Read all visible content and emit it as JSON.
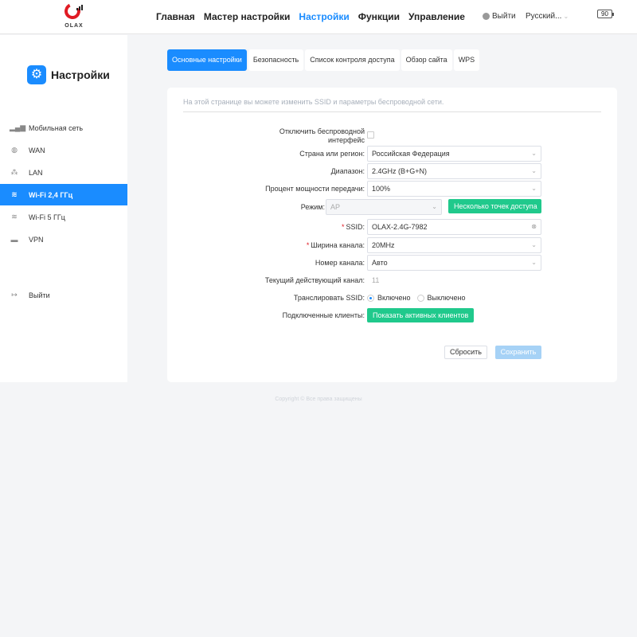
{
  "header": {
    "logo_text": "OLAX",
    "nav": [
      "Главная",
      "Мастер настройки",
      "Настройки",
      "Функции",
      "Управление"
    ],
    "nav_active_index": 2,
    "logout": "Выйти",
    "language": "Русский...",
    "battery": "90"
  },
  "sidebar": {
    "title": "Настройки",
    "items": [
      {
        "label": "Мобильная сеть",
        "icon": "signal-icon"
      },
      {
        "label": "WAN",
        "icon": "globe-icon"
      },
      {
        "label": "LAN",
        "icon": "network-icon"
      },
      {
        "label": "Wi-Fi 2,4 ГГц",
        "icon": "wifi-icon",
        "active": true
      },
      {
        "label": "Wi-Fi 5 ГГц",
        "icon": "wifi-icon"
      },
      {
        "label": "VPN",
        "icon": "vpn-icon"
      }
    ],
    "logout": "Выйти"
  },
  "tabs": [
    "Основные настройки",
    "Безопасность",
    "Список контроля доступа",
    "Обзор сайта",
    "WPS"
  ],
  "main": {
    "description": "На этой странице вы можете изменить SSID и параметры беспроводной сети.",
    "disable_label_line1": "Отключить беспроводной",
    "disable_label_line2": "интерфейс",
    "region_label": "Страна или регион:",
    "region_value": "Российская Федерация",
    "band_label": "Диапазон:",
    "band_value": "2.4GHz (B+G+N)",
    "power_label": "Процент мощности передачи:",
    "power_value": "100%",
    "mode_label": "Режим:",
    "mode_value": "AP",
    "multi_ap_button": "Несколько точек доступа",
    "ssid_label": "SSID:",
    "ssid_value": "OLAX-2.4G-7982",
    "width_label": "Ширина канала:",
    "width_value": "20MHz",
    "channel_label": "Номер канала:",
    "channel_value": "Авто",
    "current_channel_label": "Текущий действующий канал:",
    "current_channel_value": "11",
    "broadcast_label": "Транслировать SSID:",
    "broadcast_on": "Включено",
    "broadcast_off": "Выключено",
    "clients_label": "Подключенные клиенты:",
    "clients_button": "Показать активных клиентов",
    "reset_button": "Сбросить",
    "save_button": "Сохранить"
  },
  "footer": "Copyright © Все права защищены",
  "colors": {
    "accent": "#1a8cff",
    "green": "#20c98c",
    "brand_red": "#e01b24"
  }
}
